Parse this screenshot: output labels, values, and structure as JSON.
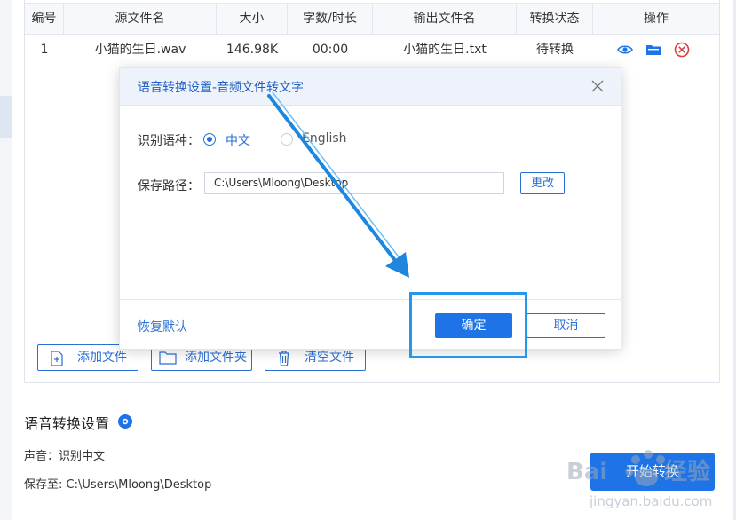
{
  "table": {
    "headers": [
      "编号",
      "源文件名",
      "大小",
      "字数/时长",
      "输出文件名",
      "转换状态",
      "操作"
    ],
    "rows": [
      {
        "index": "1",
        "source": "小猫的生日.wav",
        "size": "146.98K",
        "duration": "00:00",
        "output": "小猫的生日.txt",
        "status": "待转换"
      }
    ],
    "op_icons": [
      "eye-icon",
      "folder-icon",
      "delete-circle-icon"
    ]
  },
  "bottom_buttons": {
    "add_file": "添加文件",
    "add_folder": "添加文件夹",
    "clear_files": "清空文件"
  },
  "settings": {
    "title": "语音转换设置",
    "voice": "声音：识别中文",
    "save_to": "保存至: C:\\Users\\Mloong\\Desktop",
    "start_button": "开始转换"
  },
  "dialog": {
    "title": "语音转换设置-音频文件转文字",
    "lang_label": "识别语种：",
    "lang_options": [
      "中文",
      "English"
    ],
    "lang_selected": "中文",
    "path_label": "保存路径：",
    "path_value": "C:\\Users\\Mloong\\Desktop",
    "change_button": "更改",
    "restore_default": "恢复默认",
    "ok_button": "确定",
    "cancel_button": "取消"
  },
  "watermark": {
    "brand": "Baidu 经验",
    "url": "jingyan.baidu.com"
  },
  "colors": {
    "accent": "#1e74e6",
    "annotation": "#2597ea",
    "delete": "#e23b3b"
  }
}
